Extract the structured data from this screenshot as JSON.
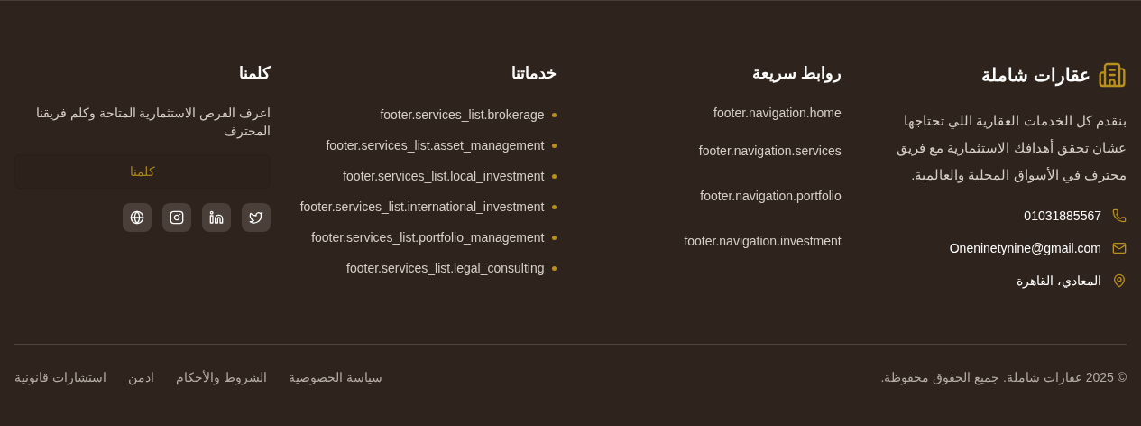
{
  "brand": {
    "name": "عقارات شاملة",
    "description": "بنقدم كل الخدمات العقارية اللي تحتاجها عشان تحقق أهدافك الاستثمارية مع فريق محترف في الأسواق المحلية والعالمية.",
    "contacts": [
      {
        "kind": "phone",
        "text": "01031885567"
      },
      {
        "kind": "email",
        "text": "Oneninetynine@gmail.com"
      },
      {
        "kind": "location",
        "text": "المعادي، القاهرة"
      }
    ]
  },
  "quick_links": {
    "title": "روابط سريعة",
    "items": [
      "footer.navigation.home",
      "footer.navigation.services",
      "footer.navigation.portfolio",
      "footer.navigation.investment"
    ]
  },
  "services": {
    "title": "خدماتنا",
    "items": [
      "footer.services_list.brokerage",
      "footer.services_list.asset_management",
      "footer.services_list.local_investment",
      "footer.services_list.international_investment",
      "footer.services_list.portfolio_management",
      "footer.services_list.legal_consulting"
    ]
  },
  "contact": {
    "title": "كلمنا",
    "text": "اعرف الفرص الاستثمارية المتاحة وكلم فريقنا المحترف",
    "button": "كلمنا",
    "socials": [
      {
        "kind": "twitter"
      },
      {
        "kind": "linkedin"
      },
      {
        "kind": "instagram"
      },
      {
        "kind": "website"
      }
    ]
  },
  "bottom": {
    "copyright": "© 2025 عقارات شاملة. جميع الحقوق محفوظة.",
    "links": [
      "سياسة الخصوصية",
      "الشروط والأحكام",
      "ادمن",
      "استشارات قانونية"
    ]
  }
}
